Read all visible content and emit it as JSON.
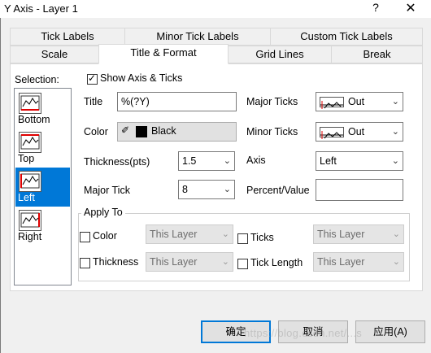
{
  "window": {
    "title": "Y Axis - Layer 1",
    "help": "?",
    "close": "✕"
  },
  "tabs_top": [
    {
      "label": "Tick Labels"
    },
    {
      "label": "Minor Tick Labels"
    },
    {
      "label": "Custom Tick Labels"
    }
  ],
  "tabs_bottom": [
    {
      "label": "Scale"
    },
    {
      "label": "Title & Format",
      "active": true
    },
    {
      "label": "Grid Lines"
    },
    {
      "label": "Break"
    }
  ],
  "selection": {
    "label": "Selection:",
    "items": [
      {
        "label": "Bottom",
        "icon": "axis-bottom-icon"
      },
      {
        "label": "Top",
        "icon": "axis-top-icon"
      },
      {
        "label": "Left",
        "icon": "axis-left-icon",
        "selected": true
      },
      {
        "label": "Right",
        "icon": "axis-right-icon"
      }
    ]
  },
  "show_axis": {
    "label": "Show Axis & Ticks",
    "checked": true
  },
  "title_field": {
    "label": "Title",
    "value": "%(?Y)"
  },
  "color_field": {
    "label": "Color",
    "value": "Black",
    "swatch": "#000000"
  },
  "thickness": {
    "label": "Thickness(pts)",
    "value": "1.5"
  },
  "major_tick": {
    "label": "Major Tick",
    "value": "8"
  },
  "major_ticks": {
    "label": "Major Ticks",
    "value": "Out"
  },
  "minor_ticks": {
    "label": "Minor Ticks",
    "value": "Out"
  },
  "axis": {
    "label": "Axis",
    "value": "Left"
  },
  "percent_value": {
    "label": "Percent/Value",
    "value": ""
  },
  "apply_to": {
    "legend": "Apply To",
    "color": {
      "label": "Color",
      "value": "This Layer"
    },
    "thickness": {
      "label": "Thickness",
      "value": "This Layer"
    },
    "ticks": {
      "label": "Ticks",
      "value": "This Layer"
    },
    "tick_length": {
      "label": "Tick Length",
      "value": "This Layer"
    }
  },
  "buttons": {
    "ok": "确定",
    "cancel": "取消",
    "apply": "应用(A)"
  },
  "watermark": "https://blog.csdn.net/...s",
  "colors": {
    "accent": "#0078d7",
    "axis_highlight": "#e00000"
  }
}
